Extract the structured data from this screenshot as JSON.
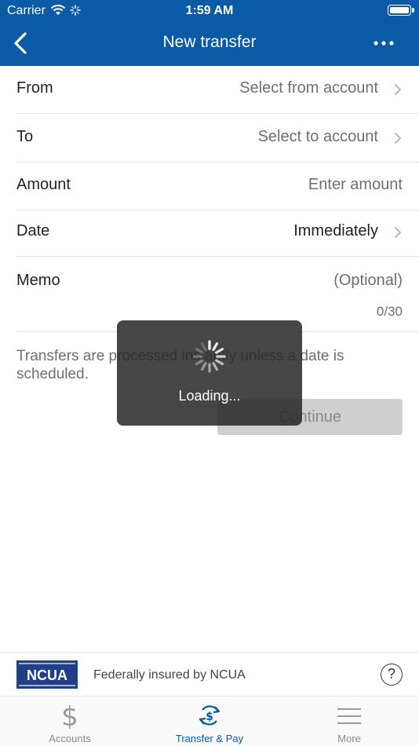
{
  "status": {
    "carrier": "Carrier",
    "time": "1:59 AM"
  },
  "nav": {
    "title": "New transfer"
  },
  "form": {
    "from": {
      "label": "From",
      "value": "Select from account"
    },
    "to": {
      "label": "To",
      "value": "Select to account"
    },
    "amount": {
      "label": "Amount",
      "placeholder": "Enter amount"
    },
    "date": {
      "label": "Date",
      "value": "Immediately"
    },
    "memo": {
      "label": "Memo",
      "placeholder": "(Optional)",
      "count": "0/30"
    }
  },
  "note": "Transfers are processed instantly unless a date is scheduled.",
  "continue_label": "Continue",
  "loading": {
    "text": "Loading..."
  },
  "ncua": {
    "logo_text": "NCUA",
    "text": "Federally insured by NCUA",
    "help": "?"
  },
  "tabs": [
    {
      "label": "Accounts",
      "icon": "dollar-icon"
    },
    {
      "label": "Transfer & Pay",
      "icon": "transfer-dollar-icon"
    },
    {
      "label": "More",
      "icon": "hamburger-icon"
    }
  ],
  "colors": {
    "brand": "#0b5aa6",
    "ncua": "#1f3f86",
    "muted": "#6f6f6f"
  }
}
